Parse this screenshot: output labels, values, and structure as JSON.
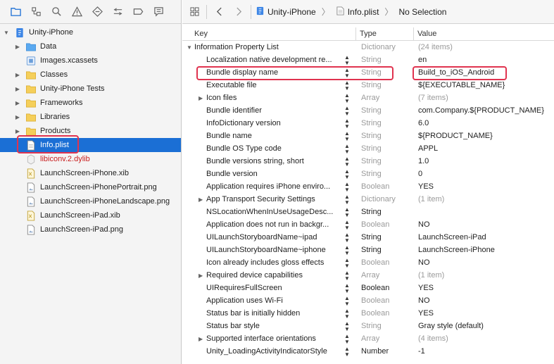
{
  "navigator": {
    "toolbar_icons": [
      "folder-icon",
      "source-control-icon",
      "search-icon",
      "warning-icon",
      "test-icon",
      "debug-icon",
      "breakpoint-icon",
      "report-icon"
    ],
    "items": [
      {
        "label": "Unity-iPhone",
        "icon": "project-icon",
        "indent": 0,
        "disclosure": "▼"
      },
      {
        "label": "Data",
        "icon": "folder-blue-icon",
        "indent": 1,
        "disclosure": "▶"
      },
      {
        "label": "Images.xcassets",
        "icon": "asset-catalog-icon",
        "indent": 1,
        "disclosure": ""
      },
      {
        "label": "Classes",
        "icon": "folder-yellow-icon",
        "indent": 1,
        "disclosure": "▶"
      },
      {
        "label": "Unity-iPhone Tests",
        "icon": "folder-yellow-icon",
        "indent": 1,
        "disclosure": "▶"
      },
      {
        "label": "Frameworks",
        "icon": "folder-yellow-icon",
        "indent": 1,
        "disclosure": "▶"
      },
      {
        "label": "Libraries",
        "icon": "folder-yellow-icon",
        "indent": 1,
        "disclosure": "▶"
      },
      {
        "label": "Products",
        "icon": "folder-yellow-icon",
        "indent": 1,
        "disclosure": "▶"
      },
      {
        "label": "Info.plist",
        "icon": "plist-file-icon",
        "indent": 1,
        "disclosure": "",
        "selected": true
      },
      {
        "label": "libiconv.2.dylib",
        "icon": "dylib-icon",
        "indent": 1,
        "disclosure": "",
        "red": true
      },
      {
        "label": "LaunchScreen-iPhone.xib",
        "icon": "xib-file-icon",
        "indent": 1,
        "disclosure": ""
      },
      {
        "label": "LaunchScreen-iPhonePortrait.png",
        "icon": "image-file-icon",
        "indent": 1,
        "disclosure": ""
      },
      {
        "label": "LaunchScreen-iPhoneLandscape.png",
        "icon": "image-file-icon",
        "indent": 1,
        "disclosure": ""
      },
      {
        "label": "LaunchScreen-iPad.xib",
        "icon": "xib-file-icon",
        "indent": 1,
        "disclosure": ""
      },
      {
        "label": "LaunchScreen-iPad.png",
        "icon": "image-file-icon",
        "indent": 1,
        "disclosure": ""
      }
    ]
  },
  "jumpbar": {
    "crumbs": [
      "Unity-iPhone",
      "Info.plist",
      "No Selection"
    ]
  },
  "plist": {
    "headers": {
      "key": "Key",
      "type": "Type",
      "value": "Value"
    },
    "rows": [
      {
        "key": "Information Property List",
        "type": "Dictionary",
        "value": "(24 items)",
        "level": 0,
        "disclosure": "▼",
        "type_dark": false,
        "value_muted": true,
        "stepper": false
      },
      {
        "key": "Localization native development re...",
        "type": "String",
        "value": "en",
        "level": 1,
        "disclosure": "",
        "type_dark": false,
        "value_muted": false,
        "stepper": true
      },
      {
        "key": "Bundle display name",
        "type": "String",
        "value": "Build_to_iOS_Android",
        "level": 1,
        "disclosure": "",
        "type_dark": false,
        "value_muted": false,
        "stepper": true
      },
      {
        "key": "Executable file",
        "type": "String",
        "value": "${EXECUTABLE_NAME}",
        "level": 1,
        "disclosure": "",
        "type_dark": false,
        "value_muted": false,
        "stepper": true
      },
      {
        "key": "Icon files",
        "type": "Array",
        "value": "(7 items)",
        "level": 1,
        "disclosure": "▶",
        "type_dark": false,
        "value_muted": true,
        "stepper": true
      },
      {
        "key": "Bundle identifier",
        "type": "String",
        "value": "com.Company.${PRODUCT_NAME}",
        "level": 1,
        "disclosure": "",
        "type_dark": false,
        "value_muted": false,
        "stepper": true
      },
      {
        "key": "InfoDictionary version",
        "type": "String",
        "value": "6.0",
        "level": 1,
        "disclosure": "",
        "type_dark": false,
        "value_muted": false,
        "stepper": true
      },
      {
        "key": "Bundle name",
        "type": "String",
        "value": "${PRODUCT_NAME}",
        "level": 1,
        "disclosure": "",
        "type_dark": false,
        "value_muted": false,
        "stepper": true
      },
      {
        "key": "Bundle OS Type code",
        "type": "String",
        "value": "APPL",
        "level": 1,
        "disclosure": "",
        "type_dark": false,
        "value_muted": false,
        "stepper": true
      },
      {
        "key": "Bundle versions string, short",
        "type": "String",
        "value": "1.0",
        "level": 1,
        "disclosure": "",
        "type_dark": false,
        "value_muted": false,
        "stepper": true
      },
      {
        "key": "Bundle version",
        "type": "String",
        "value": "0",
        "level": 1,
        "disclosure": "",
        "type_dark": false,
        "value_muted": false,
        "stepper": true
      },
      {
        "key": "Application requires iPhone enviro...",
        "type": "Boolean",
        "value": "YES",
        "level": 1,
        "disclosure": "",
        "type_dark": false,
        "value_muted": false,
        "stepper": true
      },
      {
        "key": "App Transport Security Settings",
        "type": "Dictionary",
        "value": "(1 item)",
        "level": 1,
        "disclosure": "▶",
        "type_dark": false,
        "value_muted": true,
        "stepper": true
      },
      {
        "key": "NSLocationWhenInUseUsageDesc...",
        "type": "String",
        "value": "",
        "level": 1,
        "disclosure": "",
        "type_dark": true,
        "value_muted": false,
        "stepper": true
      },
      {
        "key": "Application does not run in backgr...",
        "type": "Boolean",
        "value": "NO",
        "level": 1,
        "disclosure": "",
        "type_dark": false,
        "value_muted": false,
        "stepper": true
      },
      {
        "key": "UILaunchStoryboardName~ipad",
        "type": "String",
        "value": "LaunchScreen-iPad",
        "level": 1,
        "disclosure": "",
        "type_dark": true,
        "value_muted": false,
        "stepper": true
      },
      {
        "key": "UILaunchStoryboardName~iphone",
        "type": "String",
        "value": "LaunchScreen-iPhone",
        "level": 1,
        "disclosure": "",
        "type_dark": true,
        "value_muted": false,
        "stepper": true
      },
      {
        "key": "Icon already includes gloss effects",
        "type": "Boolean",
        "value": "NO",
        "level": 1,
        "disclosure": "",
        "type_dark": false,
        "value_muted": false,
        "stepper": true
      },
      {
        "key": "Required device capabilities",
        "type": "Array",
        "value": "(1 item)",
        "level": 1,
        "disclosure": "▶",
        "type_dark": false,
        "value_muted": true,
        "stepper": true
      },
      {
        "key": "UIRequiresFullScreen",
        "type": "Boolean",
        "value": "YES",
        "level": 1,
        "disclosure": "",
        "type_dark": true,
        "value_muted": false,
        "stepper": true
      },
      {
        "key": "Application uses Wi-Fi",
        "type": "Boolean",
        "value": "NO",
        "level": 1,
        "disclosure": "",
        "type_dark": false,
        "value_muted": false,
        "stepper": true
      },
      {
        "key": "Status bar is initially hidden",
        "type": "Boolean",
        "value": "YES",
        "level": 1,
        "disclosure": "",
        "type_dark": false,
        "value_muted": false,
        "stepper": true
      },
      {
        "key": "Status bar style",
        "type": "String",
        "value": "Gray style (default)",
        "level": 1,
        "disclosure": "",
        "type_dark": false,
        "value_muted": false,
        "stepper": true
      },
      {
        "key": "Supported interface orientations",
        "type": "Array",
        "value": "(4 items)",
        "level": 1,
        "disclosure": "▶",
        "type_dark": false,
        "value_muted": true,
        "stepper": true
      },
      {
        "key": "Unity_LoadingActivityIndicatorStyle",
        "type": "Number",
        "value": "-1",
        "level": 1,
        "disclosure": "",
        "type_dark": true,
        "value_muted": false,
        "stepper": true
      }
    ]
  },
  "colors": {
    "selection": "#1b6fd5",
    "highlight_box": "#e0334f",
    "error_text": "#c92020"
  }
}
